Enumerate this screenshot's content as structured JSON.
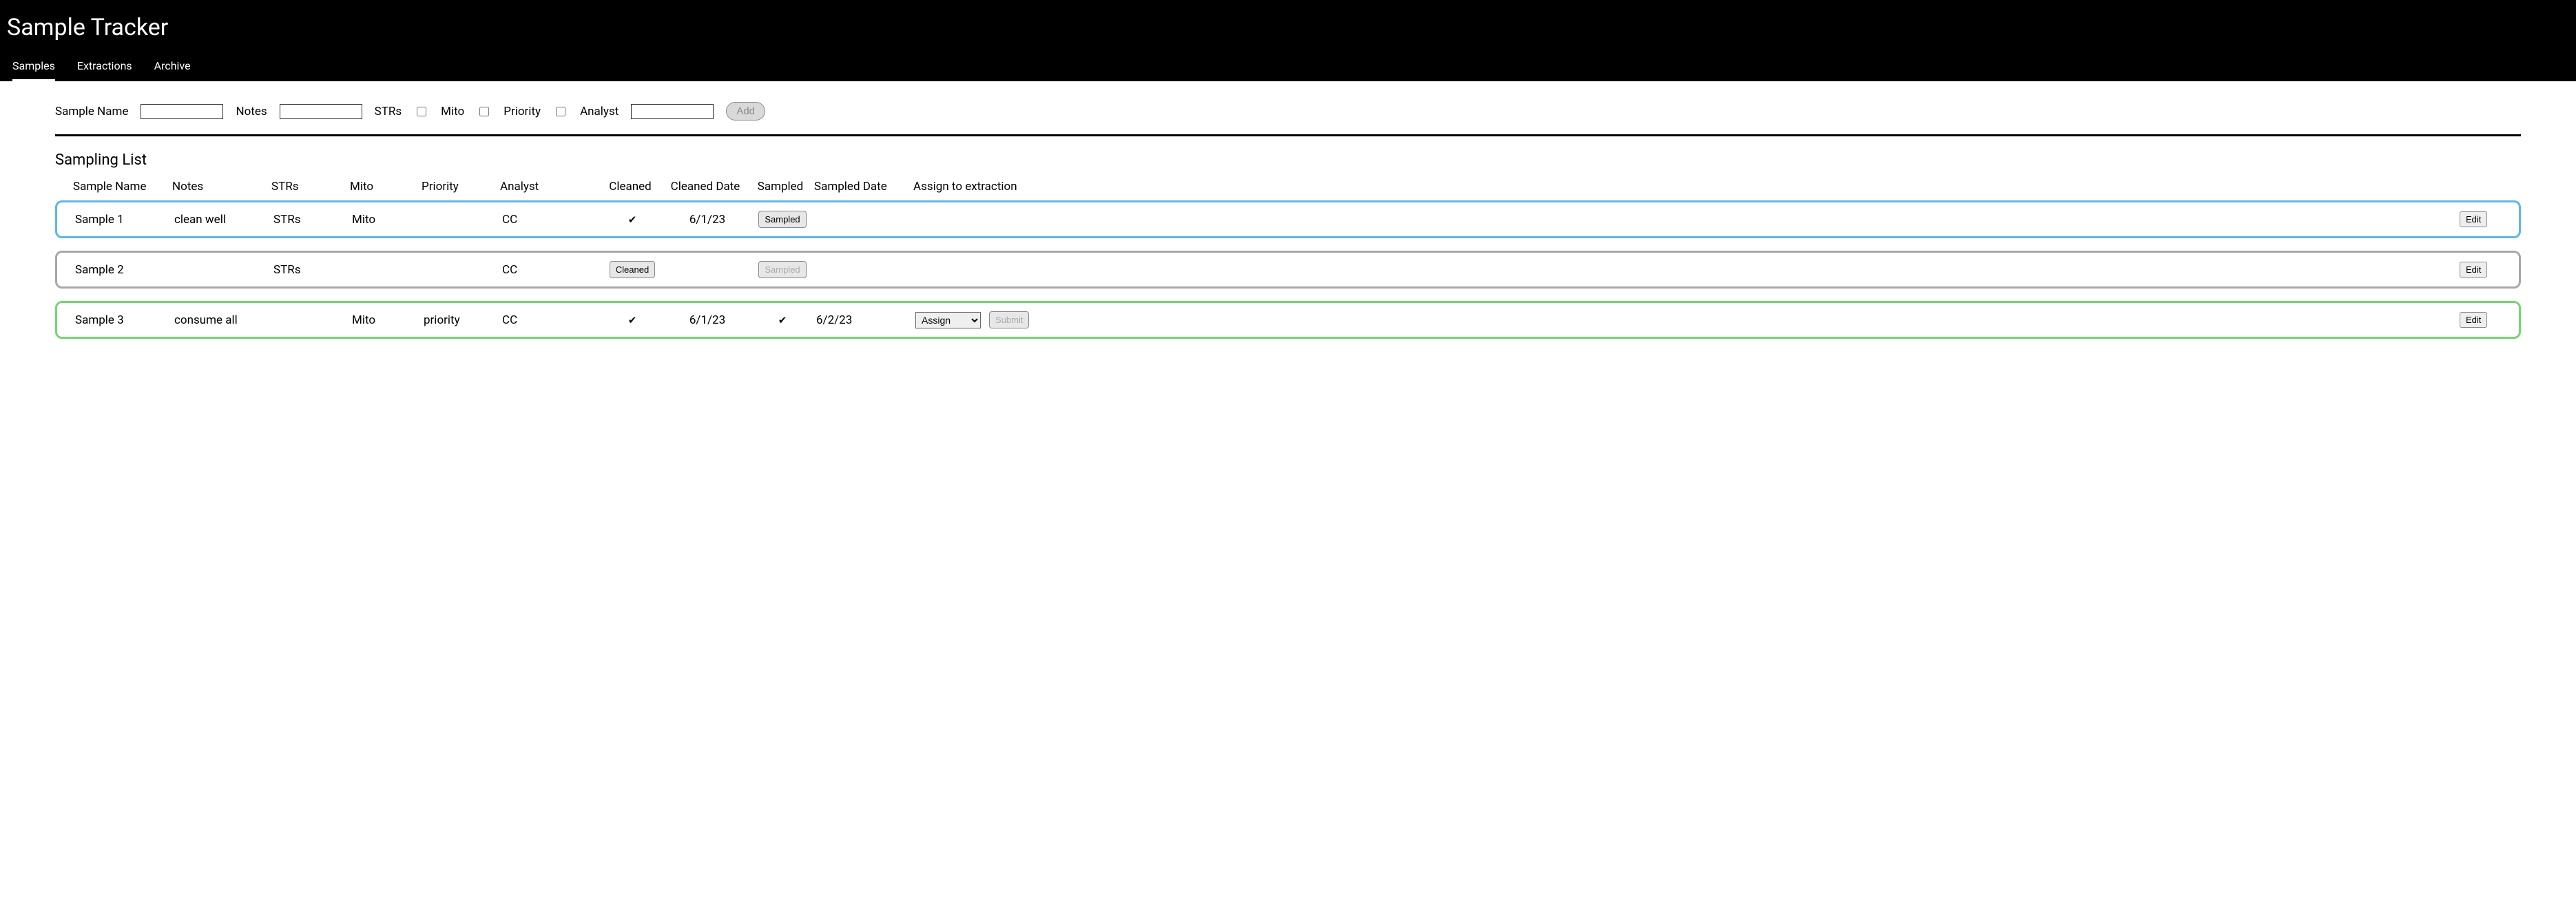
{
  "header": {
    "title": "Sample Tracker",
    "tabs": [
      {
        "label": "Samples",
        "active": true
      },
      {
        "label": "Extractions",
        "active": false
      },
      {
        "label": "Archive",
        "active": false
      }
    ]
  },
  "form": {
    "sample_name_label": "Sample Name",
    "notes_label": "Notes",
    "strs_label": "STRs",
    "mito_label": "Mito",
    "priority_label": "Priority",
    "analyst_label": "Analyst",
    "add_label": "Add"
  },
  "list": {
    "title": "Sampling List",
    "columns": {
      "sample_name": "Sample Name",
      "notes": "Notes",
      "strs": "STRs",
      "mito": "Mito",
      "priority": "Priority",
      "analyst": "Analyst",
      "cleaned": "Cleaned",
      "cleaned_date": "Cleaned Date",
      "sampled": "Sampled",
      "sampled_date": "Sampled Date",
      "assign": "Assign to extraction"
    },
    "rows": [
      {
        "color": "blue",
        "sample_name": "Sample 1",
        "notes": "clean well",
        "strs": "STRs",
        "mito": "Mito",
        "priority": "",
        "analyst": "CC",
        "cleaned_check": "✔",
        "cleaned_date": "6/1/23",
        "sampled_button": "Sampled",
        "sampled_button_disabled": false,
        "sampled_check": "",
        "sampled_date": "",
        "assign_select": "",
        "submit_label": "",
        "edit_label": "Edit"
      },
      {
        "color": "grey",
        "sample_name": "Sample 2",
        "notes": "",
        "strs": "STRs",
        "mito": "",
        "priority": "",
        "analyst": "CC",
        "cleaned_button": "Cleaned",
        "cleaned_check": "",
        "cleaned_date": "",
        "sampled_button": "Sampled",
        "sampled_button_disabled": true,
        "sampled_check": "",
        "sampled_date": "",
        "assign_select": "",
        "submit_label": "",
        "edit_label": "Edit"
      },
      {
        "color": "green",
        "sample_name": "Sample 3",
        "notes": "consume all",
        "strs": "",
        "mito": "Mito",
        "priority": "priority",
        "analyst": "CC",
        "cleaned_check": "✔",
        "cleaned_date": "6/1/23",
        "sampled_check": "✔",
        "sampled_date": "6/2/23",
        "assign_select": "Assign",
        "submit_label": "Submit",
        "submit_disabled": true,
        "edit_label": "Edit"
      }
    ]
  }
}
